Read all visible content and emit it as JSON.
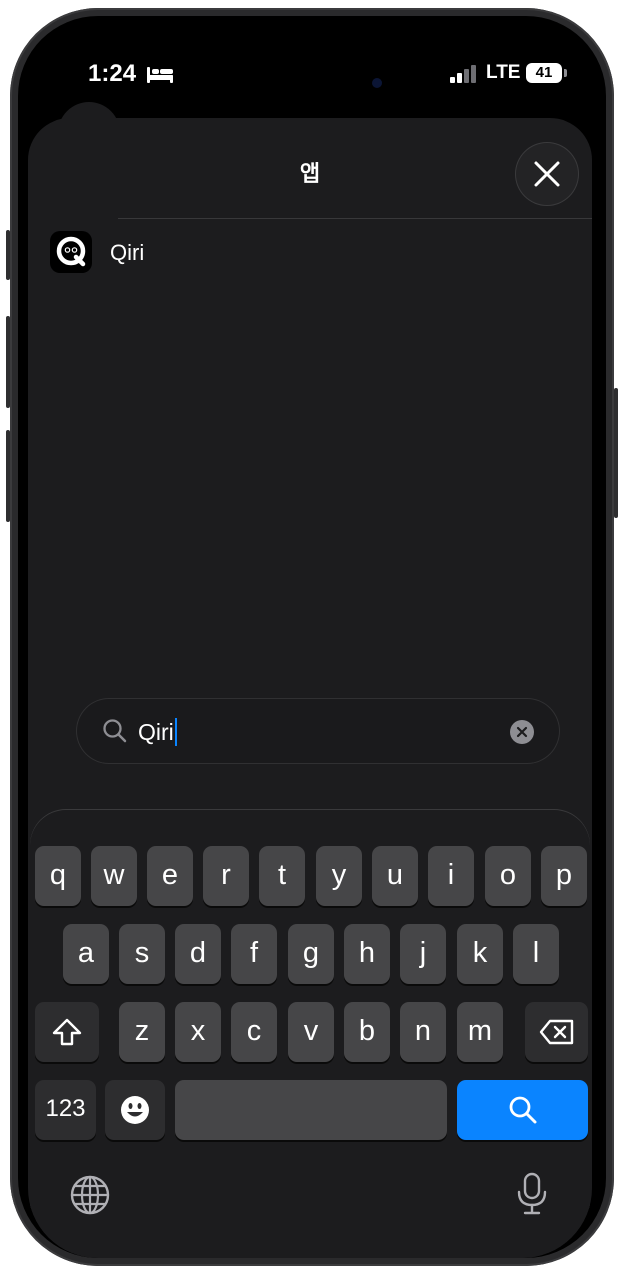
{
  "status_bar": {
    "time": "1:24",
    "network": "LTE",
    "battery": "41",
    "icons": [
      "bed-icon",
      "signal-icon",
      "battery-icon"
    ]
  },
  "sheet": {
    "title": "앱",
    "close_icon": "close-icon"
  },
  "results": [
    {
      "name": "Qiri",
      "icon": "qiri-app-icon"
    }
  ],
  "search": {
    "value": "Qiri",
    "icon": "search-icon",
    "clear_icon": "clear-icon"
  },
  "keyboard": {
    "row1": [
      "q",
      "w",
      "e",
      "r",
      "t",
      "y",
      "u",
      "i",
      "o",
      "p"
    ],
    "row2": [
      "a",
      "s",
      "d",
      "f",
      "g",
      "h",
      "j",
      "k",
      "l"
    ],
    "row3": [
      "z",
      "x",
      "c",
      "v",
      "b",
      "n",
      "m"
    ],
    "numbers_key": "123",
    "icons": [
      "shift-icon",
      "delete-icon",
      "emoji-icon",
      "search-icon",
      "globe-icon",
      "microphone-icon"
    ]
  },
  "colors": {
    "accent": "#0a84ff",
    "sheet_bg": "#1c1c1e",
    "key_bg": "#464648"
  }
}
